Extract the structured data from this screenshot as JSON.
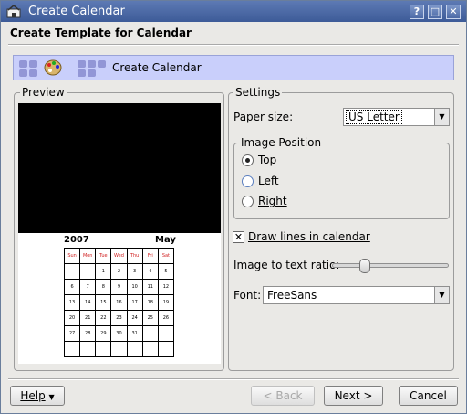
{
  "window": {
    "title": "Create Calendar",
    "buttons": [
      "?",
      "□",
      "✕"
    ]
  },
  "header": {
    "title": "Create Template for Calendar"
  },
  "banner": {
    "label": "Create Calendar"
  },
  "preview": {
    "title": "Preview",
    "year": "2007",
    "month": "May",
    "days": [
      "Sun",
      "Mon",
      "Tue",
      "Wed",
      "Thu",
      "Fri",
      "Sat"
    ],
    "weeks": [
      [
        "",
        "",
        "1",
        "2",
        "3",
        "4",
        "5"
      ],
      [
        "6",
        "7",
        "8",
        "9",
        "10",
        "11",
        "12"
      ],
      [
        "13",
        "14",
        "15",
        "16",
        "17",
        "18",
        "19"
      ],
      [
        "20",
        "21",
        "22",
        "23",
        "24",
        "25",
        "26"
      ],
      [
        "27",
        "28",
        "29",
        "30",
        "31",
        "",
        ""
      ],
      [
        "",
        "",
        "",
        "",
        "",
        "",
        ""
      ]
    ]
  },
  "settings": {
    "title": "Settings",
    "paper_size_label": "Paper size:",
    "paper_size_value": "US Letter",
    "image_position": {
      "title": "Image Position",
      "options": [
        "Top",
        "Left",
        "Right"
      ],
      "selected": "Top"
    },
    "draw_lines_label": "Draw lines in calendar",
    "draw_lines_checked": true,
    "ratio_label": "Image to text ratio:",
    "ratio_value": 0.25,
    "font_label": "Font:",
    "font_value": "FreeSans"
  },
  "buttons": {
    "help": "Help",
    "back": "< Back",
    "next": "Next >",
    "cancel": "Cancel"
  }
}
